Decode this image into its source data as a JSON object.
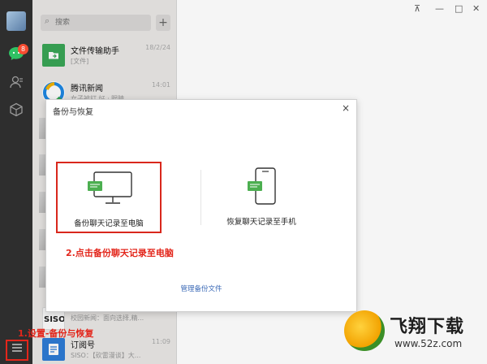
{
  "search": {
    "placeholder": "搜索"
  },
  "rail": {
    "unread_count": "8"
  },
  "chats": [
    {
      "title": "文件传输助手",
      "subtitle": "[文件]",
      "time": "18/2/24",
      "color": "#3aa757"
    },
    {
      "title": "腾讯新闻",
      "subtitle": "女子被打 好 · 眼睛 ...",
      "time": "14:01",
      "color": "#1e88e5"
    },
    {
      "title": "",
      "subtitle": "校园新闻：面向选择,精...",
      "time": "",
      "color": "#222222"
    },
    {
      "title": "订阅号",
      "subtitle": "SISO：【砍雷漫谈】大...",
      "time": "11:09",
      "color": "#2e7dd7"
    }
  ],
  "window": {
    "pin": "⊼",
    "minimize": "—",
    "maximize": "□",
    "close": "✕"
  },
  "modal": {
    "title": "备份与恢复",
    "close": "×",
    "backup_label": "备份聊天记录至电脑",
    "restore_label": "恢复聊天记录至手机",
    "manage_link": "管理备份文件"
  },
  "annotations": {
    "step1": "1.设置-备份与恢复",
    "step2": "2.点击备份聊天记录至电脑"
  },
  "watermark": {
    "brand": "飞翔下载",
    "url": "www.52z.com"
  },
  "colors": {
    "accent_green": "#2fc163",
    "annotation_red": "#e3261b",
    "link_blue": "#3d6bb7"
  }
}
